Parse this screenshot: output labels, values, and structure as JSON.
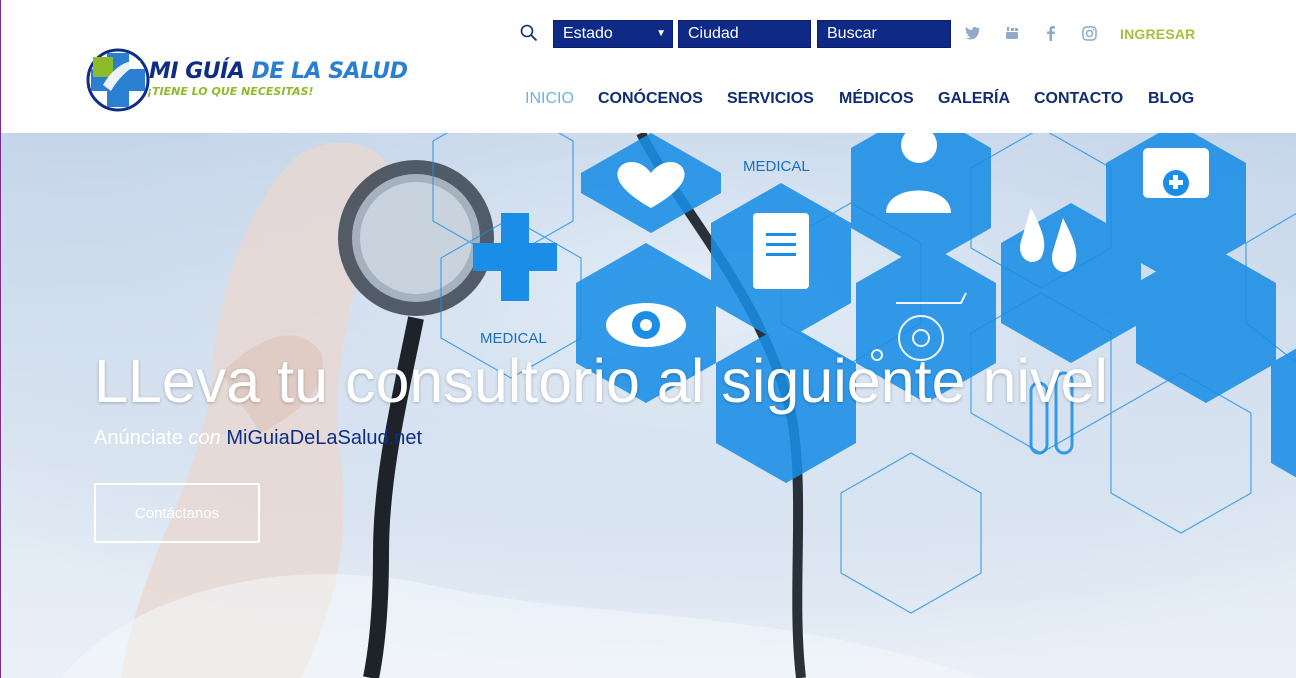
{
  "logo": {
    "line1_a": "MI GUÍA",
    "line1_b": "DE LA SALUD",
    "line2": "¡TIENE LO QUE NECESITAS!"
  },
  "search": {
    "estado": "Estado",
    "ciudad": "Ciudad",
    "buscar": "Buscar"
  },
  "social": {
    "twitter": "twitter-icon",
    "youtube": "youtube-icon",
    "facebook": "facebook-icon",
    "instagram": "instagram-icon"
  },
  "header": {
    "login": "INGRESAR"
  },
  "nav": [
    "INICIO",
    "CONÓCENOS",
    "SERVICIOS",
    "MÉDICOS",
    "GALERÍA",
    "CONTACTO",
    "BLOG"
  ],
  "hero": {
    "headline": "LLeva tu consultorio al siguiente nivel",
    "sub_prefix": "Anúnciate",
    "sub_con": "con",
    "sub_site": "MiGuiaDeLaSalud.net",
    "cta": "Contáctanos",
    "medical_label_1": "MEDICAL",
    "medical_label_2": "MEDICAL"
  },
  "colors": {
    "brand_navy": "#0e2a86",
    "accent_green": "#a4c13c",
    "nav_active": "#6cb2e4",
    "hex_blue": "#1a8ee6"
  }
}
